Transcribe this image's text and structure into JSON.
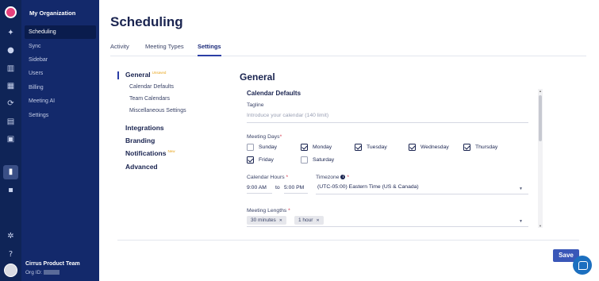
{
  "sidebar": {
    "org_name": "My Organization",
    "items": [
      {
        "label": "Scheduling",
        "active": true
      },
      {
        "label": "Sync"
      },
      {
        "label": "Sidebar"
      },
      {
        "label": "Users"
      },
      {
        "label": "Billing"
      },
      {
        "label": "Meeting AI"
      },
      {
        "label": "Settings"
      }
    ],
    "team_name": "Cirrus Product Team",
    "org_id_label": "Org ID:"
  },
  "rail_icons": [
    "logo-icon",
    "sparkle-icon",
    "user-icon",
    "bank-icon",
    "calendar-icon",
    "sync-icon",
    "sidebar-icon",
    "grid-icon",
    "document-icon",
    "lock-icon",
    "settings-icon",
    "help-icon",
    "avatar"
  ],
  "page": {
    "title": "Scheduling",
    "tabs": [
      {
        "label": "Activity"
      },
      {
        "label": "Meeting Types"
      },
      {
        "label": "Settings",
        "active": true
      }
    ]
  },
  "settings_nav": {
    "general": "General",
    "general_tag": "Unsaved",
    "subs": [
      "Calendar Defaults",
      "Team Calendars",
      "Miscellaneous Settings"
    ],
    "integrations": "Integrations",
    "branding": "Branding",
    "notifications": "Notifications",
    "notifications_tag": "New",
    "advanced": "Advanced"
  },
  "general": {
    "heading": "General",
    "section_title": "Calendar Defaults",
    "tagline_label": "Tagline",
    "tagline_placeholder": "Introduce your calendar (140 limit)",
    "meeting_days_label": "Meeting Days",
    "days": [
      {
        "label": "Sunday",
        "checked": false
      },
      {
        "label": "Monday",
        "checked": true
      },
      {
        "label": "Tuesday",
        "checked": true
      },
      {
        "label": "Wednesday",
        "checked": true
      },
      {
        "label": "Thursday",
        "checked": true
      },
      {
        "label": "Friday",
        "checked": true
      },
      {
        "label": "Saturday",
        "checked": false
      }
    ],
    "calendar_hours_label": "Calendar Hours",
    "hours_start": "9:00 AM",
    "hours_to": "to",
    "hours_end": "5:00 PM",
    "timezone_label": "Timezone",
    "timezone_value": "(UTC-05:00) Eastern Time (US & Canada)",
    "meeting_lengths_label": "Meeting Lengths",
    "meeting_lengths": [
      "30 minutes",
      "1 hour"
    ]
  },
  "footer": {
    "save_label": "Save"
  },
  "colors": {
    "sidebar": "#13296b",
    "rail": "#0f2457",
    "accent": "#3a57b8",
    "tag": "#e8a317"
  }
}
